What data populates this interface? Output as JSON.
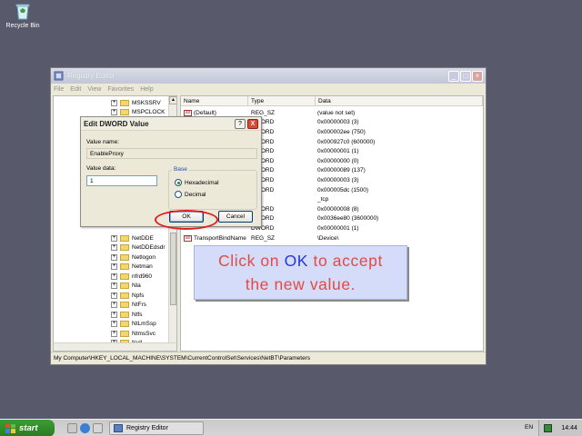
{
  "desktop": {
    "recycle_bin_label": "Recycle Bin"
  },
  "window": {
    "title": "Registry Editor",
    "menu": [
      "File",
      "Edit",
      "View",
      "Favorites",
      "Help"
    ],
    "tree_items_top": [
      "MSKSSRV",
      "MSPCLOCK"
    ],
    "tree_items_bottom": [
      "NetDDE",
      "NetDDEdsdr",
      "Netlogon",
      "Netman",
      "nfrd960",
      "Nla",
      "Npfs",
      "NtFrs",
      "Ntfs",
      "NtLmSsp",
      "NtmsSvc",
      "Null"
    ],
    "columns": {
      "name": "Name",
      "type": "Type",
      "data": "Data"
    },
    "rows": [
      {
        "name": "(Default)",
        "type": "REG_SZ",
        "data": "(value not set)"
      },
      {
        "name": "",
        "type": "DWORD",
        "data": "0x00000003 (3)"
      },
      {
        "name": "",
        "type": "DWORD",
        "data": "0x000002ee (750)"
      },
      {
        "name": "",
        "type": "DWORD",
        "data": "0x000927c0 (600000)"
      },
      {
        "name": "",
        "type": "DWORD",
        "data": "0x00000001 (1)"
      },
      {
        "name": "",
        "type": "DWORD",
        "data": "0x00000000 (0)"
      },
      {
        "name": "",
        "type": "DWORD",
        "data": "0x00000089 (137)"
      },
      {
        "name": "",
        "type": "DWORD",
        "data": "0x00000003 (3)"
      },
      {
        "name": "",
        "type": "DWORD",
        "data": "0x000005dc (1500)"
      },
      {
        "name": "",
        "type": "SZ",
        "data": "_tcp"
      },
      {
        "name": "",
        "type": "DWORD",
        "data": "0x00000008 (8)"
      },
      {
        "name": "",
        "type": "DWORD",
        "data": "0x0036ee80 (3600000)"
      },
      {
        "name": "",
        "type": "DWORD",
        "data": "0x00000001 (1)"
      },
      {
        "name": "TransportBindName",
        "type": "REG_SZ",
        "data": "\\Device\\"
      }
    ],
    "status_path": "My Computer\\HKEY_LOCAL_MACHINE\\SYSTEM\\CurrentControlSet\\Services\\NetBT\\Parameters"
  },
  "dialog": {
    "title": "Edit DWORD Value",
    "value_name_label": "Value name:",
    "value_name": "EnableProxy",
    "value_data_label": "Value data:",
    "value_data": "1",
    "base_label": "Base",
    "radio_hex": "Hexadecimal",
    "radio_dec": "Decimal",
    "ok_label": "OK",
    "cancel_label": "Cancel",
    "help_label": "?",
    "close_label": "X"
  },
  "callout": {
    "line1_pre": "Click on ",
    "line1_hl": "OK",
    "line1_post": " to accept",
    "line2": "the new value."
  },
  "taskbar": {
    "start_label": "start",
    "task_label": "Registry Editor",
    "lang": "EN",
    "clock": "14:44"
  }
}
